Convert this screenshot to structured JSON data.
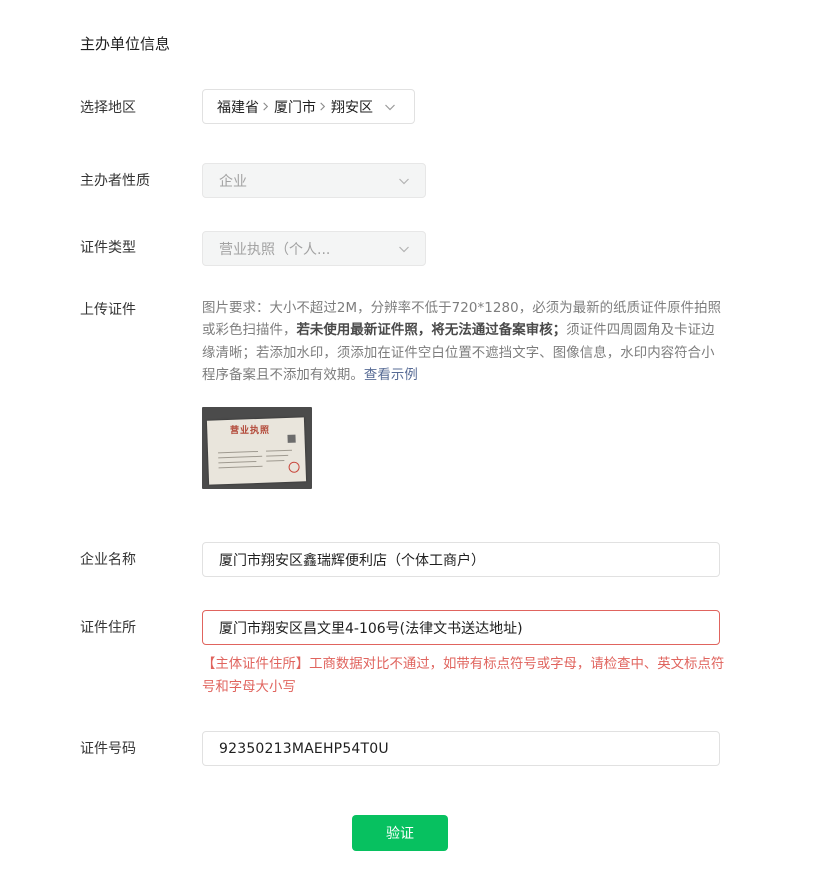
{
  "section": {
    "title": "主办单位信息"
  },
  "region": {
    "label": "选择地区",
    "province": "福建省",
    "city": "厦门市",
    "district": "翔安区"
  },
  "nature": {
    "label": "主办者性质",
    "value": "企业"
  },
  "cert_type": {
    "label": "证件类型",
    "value": "营业执照（个人..."
  },
  "upload": {
    "label": "上传证件",
    "desc_part1": "图片要求：大小不超过2M，分辨率不低于720*1280，必须为最新的纸质证件原件拍照或彩色扫描件，",
    "desc_strong": "若未使用最新证件照，将无法通过备案审核；",
    "desc_part2": "须证件四周圆角及卡证边缘清晰；若添加水印，须添加在证件空白位置不遮挡文字、图像信息，水印内容符合小程序备案且不添加有效期。",
    "example_link": "查看示例"
  },
  "company_name": {
    "label": "企业名称",
    "value": "厦门市翔安区鑫瑞辉便利店（个体工商户）"
  },
  "cert_address": {
    "label": "证件住所",
    "value": "厦门市翔安区昌文里4-106号(法律文书送达地址)",
    "error": "【主体证件住所】工商数据对比不通过，如带有标点符号或字母，请检查中、英文标点符号和字母大小写"
  },
  "cert_number": {
    "label": "证件号码",
    "value": "92350213MAEHP54T0U"
  },
  "submit": {
    "label": "验证"
  },
  "colors": {
    "primary": "#07c160",
    "error": "#e0645e",
    "link": "#576b95"
  }
}
